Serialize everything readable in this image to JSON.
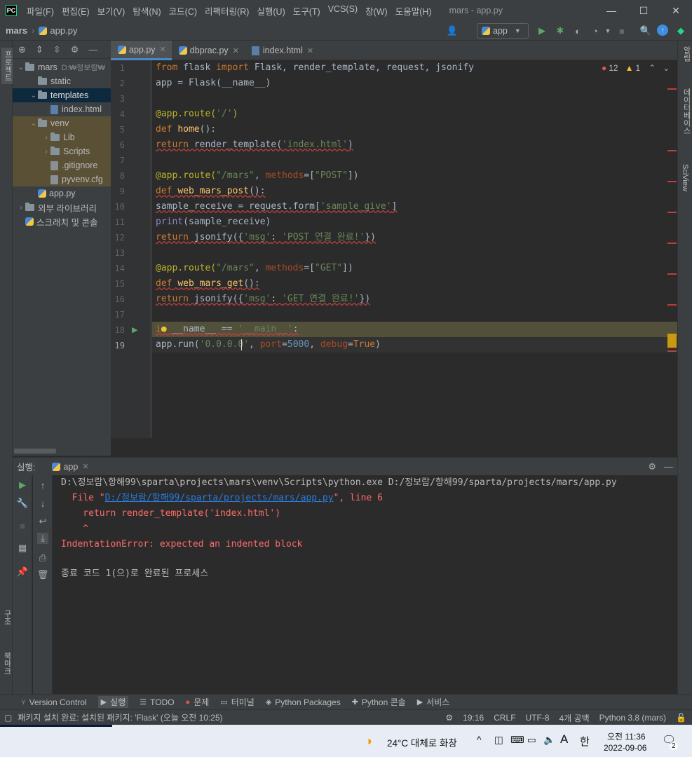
{
  "titlebar": {
    "logo": "PC",
    "menu": [
      "파일(F)",
      "편집(E)",
      "보기(V)",
      "탐색(N)",
      "코드(C)",
      "리팩터링(R)",
      "실행(U)",
      "도구(T)",
      "VCS(S)",
      "창(W)",
      "도움말(H)"
    ],
    "title": "mars - app.py",
    "controls": [
      "—",
      "☐",
      "✕"
    ]
  },
  "navbar": {
    "project": "mars",
    "file": "app.py",
    "run_config": "app"
  },
  "left_stripe": {
    "project": "프로젝트",
    "structure": "구조",
    "bookmarks": "북마크"
  },
  "right_stripe": {
    "notifications": "알림",
    "database": "데이터베이스",
    "sciview": "SciView"
  },
  "project_tree": [
    {
      "label": "mars",
      "extra": "D:₩정보람₩",
      "indent": 0,
      "arrow": "⌄",
      "icon": "folder"
    },
    {
      "label": "static",
      "indent": 1,
      "arrow": "",
      "icon": "folder"
    },
    {
      "label": "templates",
      "indent": 1,
      "arrow": "⌄",
      "icon": "folder",
      "selected": true
    },
    {
      "label": "index.html",
      "indent": 2,
      "arrow": "",
      "icon": "html"
    },
    {
      "label": "venv",
      "indent": 1,
      "arrow": "⌄",
      "icon": "folder",
      "excluded": true
    },
    {
      "label": "Lib",
      "indent": 2,
      "arrow": "›",
      "icon": "folder",
      "excluded": true
    },
    {
      "label": "Scripts",
      "indent": 2,
      "arrow": "›",
      "icon": "folder",
      "excluded": true
    },
    {
      "label": ".gitignore",
      "indent": 2,
      "arrow": "",
      "icon": "file",
      "excluded": true
    },
    {
      "label": "pyvenv.cfg",
      "indent": 2,
      "arrow": "",
      "icon": "cfg",
      "excluded": true
    },
    {
      "label": "app.py",
      "indent": 1,
      "arrow": "",
      "icon": "py"
    },
    {
      "label": "외부 라이브러리",
      "indent": 0,
      "arrow": "›",
      "icon": "lib"
    },
    {
      "label": "스크래치 및 콘솔",
      "indent": 0,
      "arrow": "",
      "icon": "scratch"
    }
  ],
  "tabs": [
    {
      "label": "app.py",
      "active": true
    },
    {
      "label": "dbprac.py",
      "active": false
    },
    {
      "label": "index.html",
      "active": false
    }
  ],
  "inspection": {
    "errors": "12",
    "warnings": "1"
  },
  "line_numbers": [
    "1",
    "2",
    "3",
    "4",
    "5",
    "6",
    "7",
    "8",
    "9",
    "10",
    "11",
    "12",
    "13",
    "14",
    "15",
    "16",
    "17",
    "18",
    "19"
  ],
  "code": {
    "l1": {
      "kw1": "from",
      "sp1": " flask ",
      "kw2": "import",
      "rest": " Flask, render_template, request, jsonify"
    },
    "l2": "app = Flask(__name__)",
    "l4": {
      "dec": "@app.route(",
      "str": "'/'",
      "close": ")"
    },
    "l5": {
      "kw": "def",
      "sp": " ",
      "fn": "home",
      "rest": "():"
    },
    "l6": {
      "kw": "return",
      "rest": " render_template(",
      "str": "'index.html'",
      "close": ")"
    },
    "l8": {
      "dec": "@app.route(",
      "str": "\"/mars\"",
      "comma": ", ",
      "kwarg": "methods",
      "eq": "=[",
      "str2": "\"POST\"",
      "close": "])"
    },
    "l9": {
      "kw": "def",
      "sp": " ",
      "fn": "web_mars_post",
      "rest": "():"
    },
    "l10": {
      "pre": "sample_receive = request.form[",
      "str": "'sample_give'",
      "close": "]"
    },
    "l11": {
      "bi": "print",
      "rest": "(sample_receive)"
    },
    "l12": {
      "kw": "return",
      "rest": " jsonify({",
      "str1": "'msg'",
      "colon": ": ",
      "str2": "'POST 연결 완료!'",
      "close": "})"
    },
    "l14": {
      "dec": "@app.route(",
      "str": "\"/mars\"",
      "comma": ", ",
      "kwarg": "methods",
      "eq": "=[",
      "str2": "\"GET\"",
      "close": "])"
    },
    "l15": {
      "kw": "def",
      "sp": " ",
      "fn": "web_mars_get",
      "rest": "():"
    },
    "l16": {
      "kw": "return",
      "rest": " jsonify({",
      "str1": "'msg'",
      "colon": ": ",
      "str2": "'GET 연결 완료!'",
      "close": "})"
    },
    "l18": {
      "i": "i",
      "mid": " __name__ == ",
      "str": "'__main__'",
      "close": ":"
    },
    "l19": {
      "pre": "app.run(",
      "str": "'0.0.0.0'",
      "comma": ", ",
      "kw1": "port",
      "eq1": "=",
      "num": "5000",
      "comma2": ", ",
      "kw2": "debug",
      "eq2": "=",
      "kwv": "True",
      "close": ")"
    }
  },
  "run_panel": {
    "label": "실행:",
    "tab": "app"
  },
  "console": {
    "line1": "D:\\정보람\\항해99\\sparta\\projects\\mars\\venv\\Scripts\\python.exe D:/정보람/항해99/sparta/projects/mars/app.py",
    "line2_pre": "  File \"",
    "line2_link": "D:/정보람/항해99/sparta/projects/mars/app.py",
    "line2_post": "\", line 6",
    "line3": "    return render_template('index.html')",
    "line4": "    ^",
    "line5": "IndentationError: expected an indented block",
    "line6": "종료 코드 1(으)로 완료된 프로세스"
  },
  "bottom_tabs": [
    "Version Control",
    "실행",
    "TODO",
    "문제",
    "터미널",
    "Python Packages",
    "Python 콘솔",
    "서비스"
  ],
  "status": {
    "message": "패키지 설치 완료: 설치된 패키지: 'Flask' (오늘 오전 10:25)",
    "position": "19:16",
    "line_sep": "CRLF",
    "encoding": "UTF-8",
    "indent": "4개 공백",
    "interpreter": "Python 3.8 (mars)"
  },
  "taskbar": {
    "weather": "24°C  대체로 화창",
    "ime1": "A",
    "ime2": "한",
    "time": "오전 11:36",
    "date": "2022-09-06",
    "notif": "2"
  },
  "colors": {
    "bg": "#2b2b2b",
    "panel": "#3c3f41",
    "keyword": "#cc7832",
    "string": "#6a8759",
    "error": "#ff6b68",
    "link": "#287bde"
  }
}
